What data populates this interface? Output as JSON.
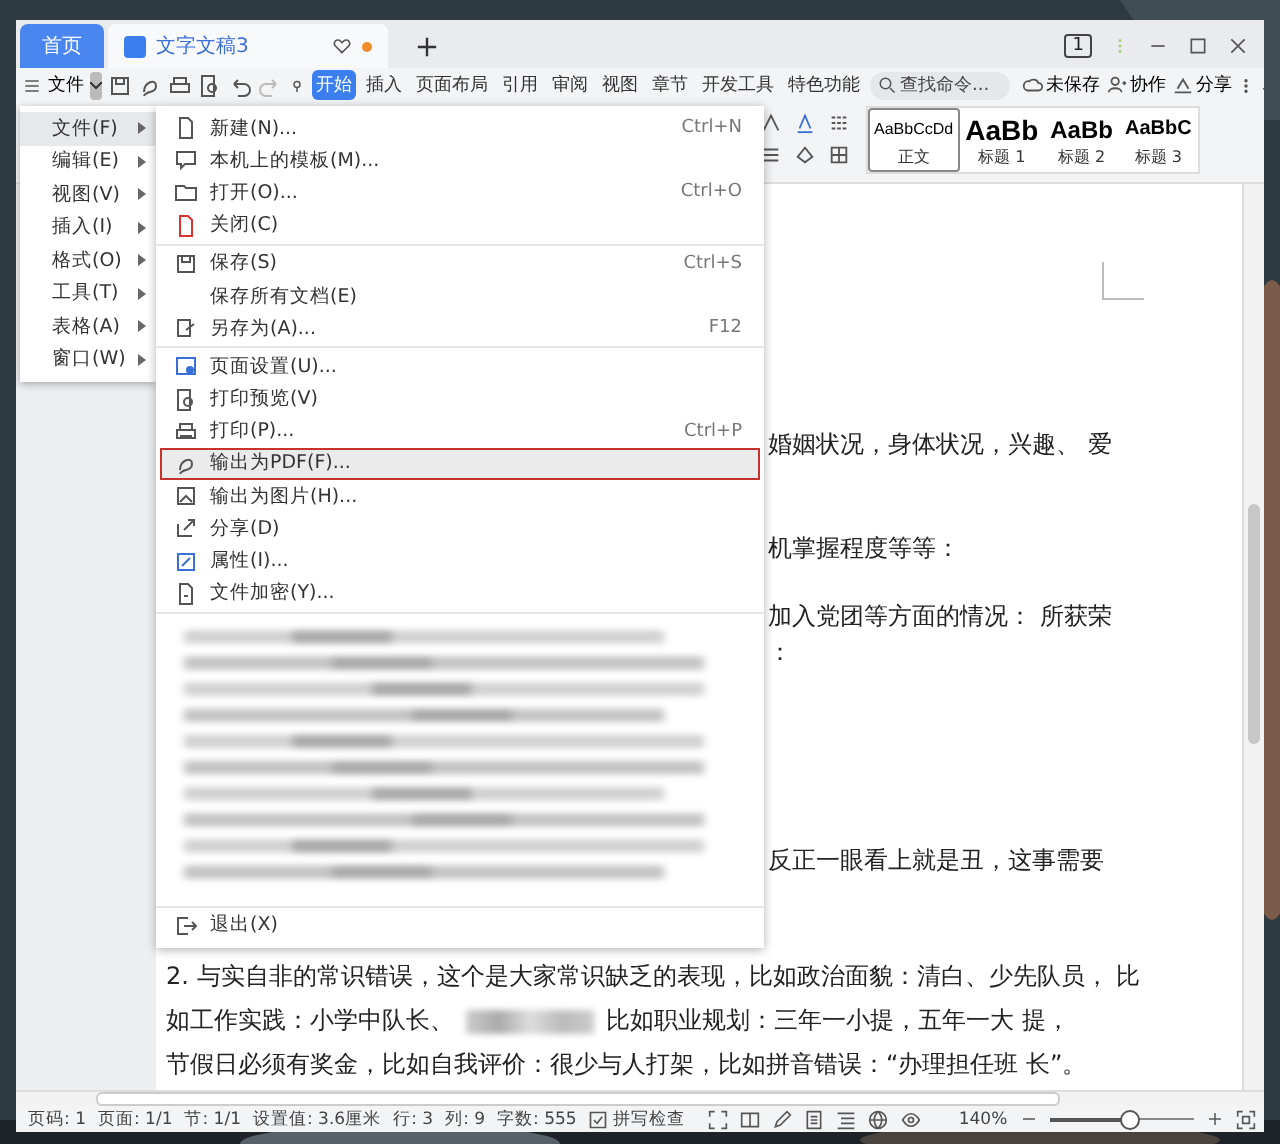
{
  "tabs": [
    {
      "label": "首页",
      "kind": "home",
      "selected": false
    },
    {
      "label": "文字文稿3",
      "kind": "document",
      "selected": true,
      "modified": true
    }
  ],
  "window_count": "1",
  "command_bar": {
    "menu_label": "文件",
    "ribbon_tabs": [
      {
        "label": "开始",
        "selected": true
      },
      {
        "label": "插入",
        "selected": false
      },
      {
        "label": "页面布局",
        "selected": false
      },
      {
        "label": "引用",
        "selected": false
      },
      {
        "label": "审阅",
        "selected": false
      },
      {
        "label": "视图",
        "selected": false
      },
      {
        "label": "章节",
        "selected": false
      },
      {
        "label": "开发工具",
        "selected": false
      },
      {
        "label": "特色功能",
        "selected": false
      }
    ],
    "search": {
      "placeholder": "查找命令..."
    },
    "actions": [
      {
        "label": "未保存",
        "kind": "cloud"
      },
      {
        "label": "协作",
        "kind": "person"
      },
      {
        "label": "分享",
        "kind": "share"
      }
    ]
  },
  "styles": [
    {
      "sample": "AaBbCcDd",
      "name": "正文",
      "kind": "normal",
      "selected": true
    },
    {
      "sample": "AaBb",
      "name": "标题 1",
      "kind": "h1",
      "selected": false
    },
    {
      "sample": "AaBb",
      "name": "标题 2",
      "kind": "h2",
      "selected": false
    },
    {
      "sample": "AaBbC",
      "name": "标题 3",
      "kind": "h3",
      "selected": false
    }
  ],
  "main_menu": [
    {
      "label": "文件(F)",
      "selected": true
    },
    {
      "label": "编辑(E)",
      "selected": false
    },
    {
      "label": "视图(V)",
      "selected": false
    },
    {
      "label": "插入(I)",
      "selected": false
    },
    {
      "label": "格式(O)",
      "selected": false
    },
    {
      "label": "工具(T)",
      "selected": false
    },
    {
      "label": "表格(A)",
      "selected": false
    },
    {
      "label": "窗口(W)",
      "selected": false
    }
  ],
  "file_menu": [
    {
      "kind": "items",
      "items": [
        {
          "label": "新建(N)...",
          "shortcut": "Ctrl+N",
          "kind": "new",
          "selected": false
        },
        {
          "label": "本机上的模板(M)...",
          "kind": "template",
          "selected": false
        },
        {
          "label": "打开(O)...",
          "shortcut": "Ctrl+O",
          "kind": "open",
          "selected": false
        },
        {
          "label": "关闭(C)",
          "kind": "close",
          "selected": false
        }
      ]
    },
    {
      "kind": "items",
      "items": [
        {
          "label": "保存(S)",
          "shortcut": "Ctrl+S",
          "kind": "save",
          "selected": false
        },
        {
          "label": "保存所有文档(E)",
          "kind": "plain",
          "selected": false
        },
        {
          "label": "另存为(A)...",
          "shortcut": "F12",
          "kind": "saveas",
          "selected": false
        }
      ]
    },
    {
      "kind": "items",
      "items": [
        {
          "label": "页面设置(U)...",
          "kind": "page",
          "selected": false
        },
        {
          "label": "打印预览(V)",
          "kind": "preview",
          "selected": false
        },
        {
          "label": "打印(P)...",
          "shortcut": "Ctrl+P",
          "kind": "print",
          "selected": false
        },
        {
          "label": "输出为PDF(F)...",
          "kind": "pdf",
          "selected": true
        },
        {
          "label": "输出为图片(H)...",
          "selected": false
        },
        {
          "label": "分享(D)",
          "kind": "share",
          "selected": false
        },
        {
          "label": "属性(I)...",
          "kind": "props",
          "selected": false
        },
        {
          "label": "文件加密(Y)...",
          "kind": "lock",
          "selected": false
        }
      ]
    },
    {
      "kind": "blurred"
    },
    {
      "kind": "items",
      "items": [
        {
          "label": "退出(X)",
          "kind": "exit",
          "selected": false
        }
      ]
    }
  ],
  "document": [
    {
      "kind": "fragment",
      "text": "婚姻状况，身体状况，兴趣、 爱"
    },
    {
      "kind": "fragment",
      "text": "机掌握程度等等："
    },
    {
      "kind": "fragment",
      "text": "加入党团等方面的情况：  所获荣"
    },
    {
      "kind": "fragment",
      "text": "："
    },
    {
      "kind": "fragment",
      "text": "反正一眼看上就是丑，这事需要"
    },
    {
      "kind": "full",
      "text": "2. 与实自非的常识错误，这个是大家常识缺乏的表现，比如政治面貌：清白、少先队员， 比"
    },
    {
      "kind": "redacted",
      "text": "如工作实践：小学中队长、",
      "text_after": "比如职业规划：三年一小提，五年一大 提，"
    },
    {
      "kind": "full",
      "text": "节假日必须有奖金，比如自我评价：很少与人打架，比如拼音错误：“办理担任班 长”。"
    }
  ],
  "status_bar": {
    "fields": [
      "页码: 1",
      "页面: 1/1",
      "节: 1/1",
      "设置值: 3.6厘米",
      "行: 3",
      "列: 9",
      "字数: 555"
    ],
    "spell_check": {
      "label": "拼写检查",
      "checked": true
    },
    "zoom": {
      "value": "140%",
      "level": 0.55
    }
  }
}
